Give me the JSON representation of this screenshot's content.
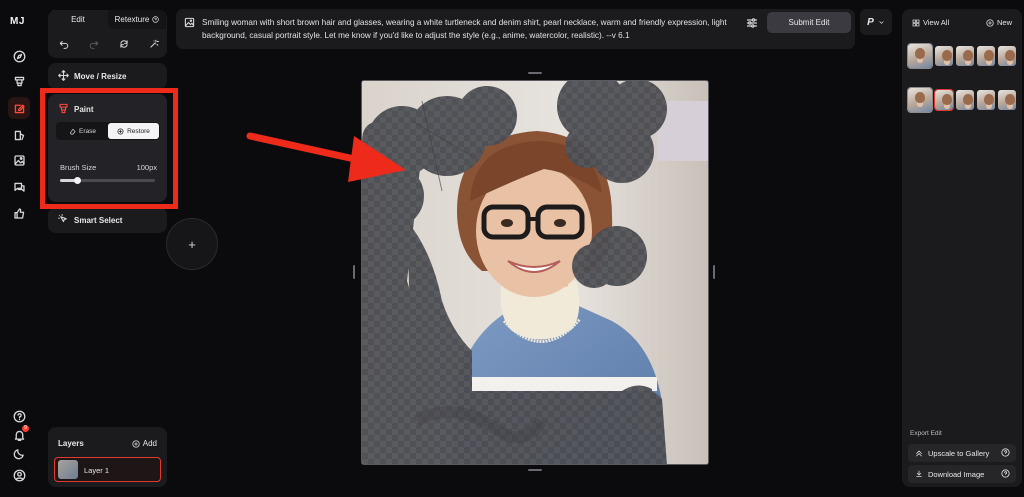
{
  "app": {
    "logo": "MJ"
  },
  "tool_panel": {
    "tabs": [
      {
        "label": "Edit"
      },
      {
        "label": "Retexture"
      }
    ],
    "move_resize_label": "Move / Resize",
    "paint": {
      "label": "Paint",
      "erase_label": "Erase",
      "restore_label": "Restore",
      "selected_mode": "Restore",
      "brush_size_label": "Brush Size",
      "brush_size_value": "100px",
      "brush_size_fraction": 0.18
    },
    "smart_select_label": "Smart Select"
  },
  "layers": {
    "title": "Layers",
    "add_label": "Add",
    "items": [
      {
        "name": "Layer 1"
      }
    ]
  },
  "prompt": {
    "text": "Smiling woman with short brown hair and glasses, wearing a white turtleneck and denim shirt, pearl necklace, warm and friendly expression, light background, casual portrait style. Let me know if you'd like to adjust the style (e.g., anime, watercolor, realistic). --v 6.1",
    "submit_label": "Submit Edit",
    "persona_label": "P"
  },
  "right_panel": {
    "view_all_label": "View All",
    "new_label": "New",
    "export_title": "Export Edit",
    "upscale_label": "Upscale to Gallery",
    "download_label": "Download Image"
  },
  "notifications": {
    "count": "9"
  },
  "colors": {
    "accent_red": "#ee2a1b",
    "background": "#0b0b0d",
    "panel": "#1b1b1e"
  }
}
